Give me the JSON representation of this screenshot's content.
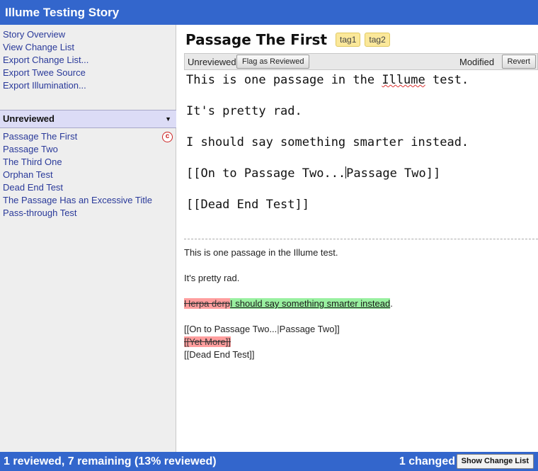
{
  "app": {
    "title": "Illume Testing Story"
  },
  "sidebar": {
    "menu": [
      "Story Overview",
      "View Change List",
      "Export Change List...",
      "Export Twee Source",
      "Export Illumination..."
    ],
    "filter": {
      "label": "Unreviewed",
      "caret": "▼"
    },
    "passages": [
      "Passage The First",
      "Passage Two",
      "The Third One",
      "Orphan Test",
      "Dead End Test",
      "The Passage Has an Excessive Title",
      "Pass-through Test"
    ],
    "changed_marker": "c"
  },
  "passage": {
    "title": "Passage The First",
    "tags": [
      "tag1",
      "tag2"
    ],
    "status": "Unreviewed",
    "flag_button": "Flag as Reviewed",
    "modified_label": "Modified",
    "revert_button": "Revert"
  },
  "source": {
    "line1_pre": "This is one passage in the ",
    "line1_word": "Illume",
    "line1_post": " test.",
    "line2": "It's pretty rad.",
    "line3": "I should say something smarter instead.",
    "line4_pre": "[[On to Passage Two...",
    "line4_post": "Passage Two]]",
    "line5": "[[Dead End Test]]"
  },
  "preview": {
    "line1": "This is one passage in the Illume test.",
    "line2": "It's pretty rad.",
    "deleted_text": "Herpa derp",
    "inserted_text": "I should say something smarter instead",
    "line3_end": ".",
    "link_pre": "[[On to Passage Two...",
    "link_sep": "|",
    "link_post": "Passage Two]]",
    "deleted_link": "[[Yet More]]",
    "dead_end": "[[Dead End Test]]"
  },
  "footer": {
    "progress": "1 reviewed, 7 remaining (13% reviewed)",
    "changed": "1 changed",
    "show_button": "Show Change List"
  },
  "colors": {
    "accent": "#3366cc",
    "sidebar_bg": "#eeeeee",
    "link": "#2a3a9a",
    "tag_bg": "#fbe89a",
    "deleted": "#ff9e9e",
    "inserted": "#99f0a0",
    "changed_mark": "#cc2222"
  }
}
